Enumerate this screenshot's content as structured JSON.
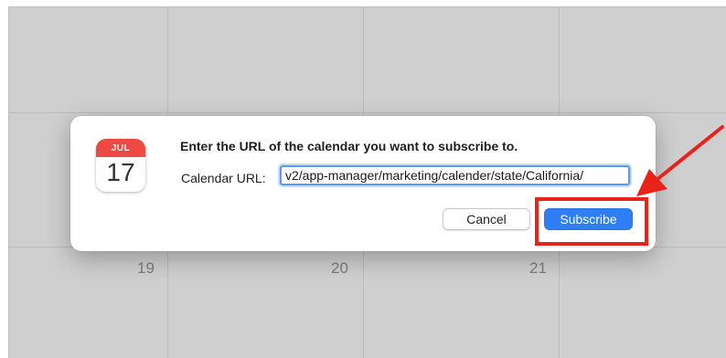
{
  "calendar": {
    "day_numbers": [
      "19",
      "20",
      "21"
    ]
  },
  "dialog": {
    "icon_month": "JUL",
    "icon_day": "17",
    "title": "Enter the URL of the calendar you want to subscribe to.",
    "url_label": "Calendar URL:",
    "url_value": "v2/app-manager/marketing/calender/state/California/",
    "cancel_label": "Cancel",
    "subscribe_label": "Subscribe"
  },
  "colors": {
    "accent": "#2f7ef6",
    "annotation": "#e8231a",
    "calendar_icon_red": "#ee4a44"
  },
  "icons": {
    "app_icon": "calendar-app-icon",
    "annotation_arrow": "red-arrow-icon"
  }
}
